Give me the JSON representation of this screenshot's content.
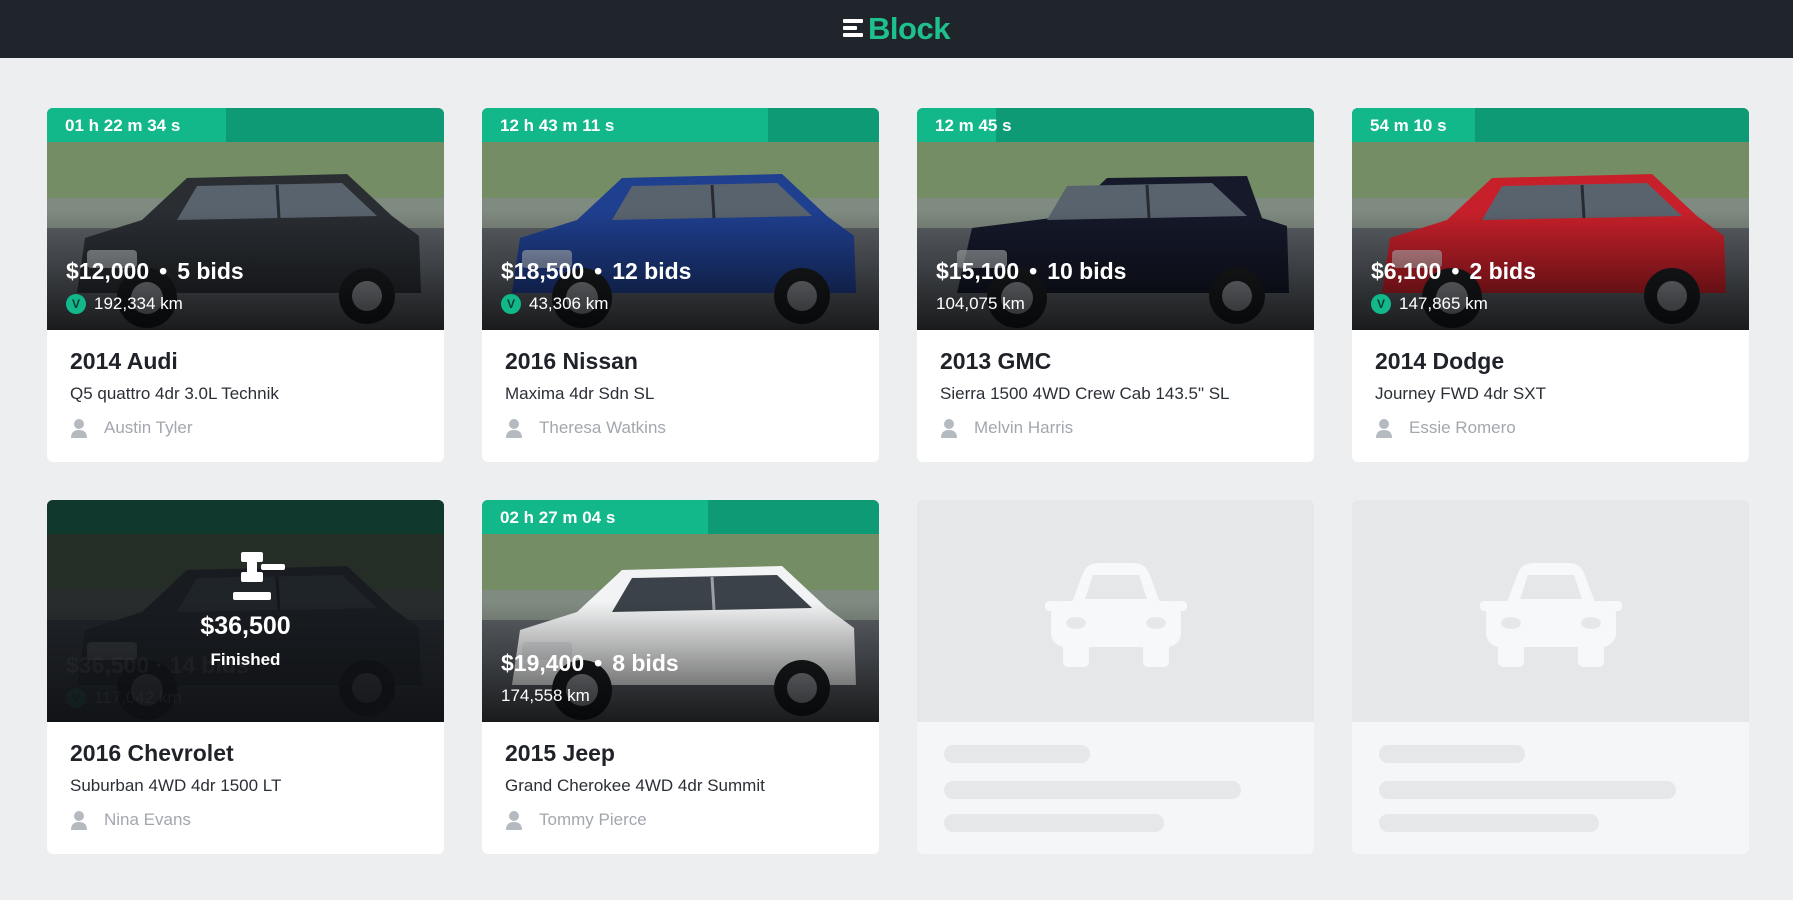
{
  "app": {
    "brand": "Block",
    "brand_color": "#1ec08f",
    "header_bg": "#20242b"
  },
  "listings": [
    {
      "timer": "01 h 22 m 34 s",
      "timer_progress": 0.45,
      "price": "$12,000",
      "bids": "5 bids",
      "km": "192,334 km",
      "verified": true,
      "title": "2014 Audi",
      "model": "Q5 quattro 4dr 3.0L Technik",
      "seller": "Austin Tyler",
      "car_color": "#2a2e33",
      "photo_icon": "car-photo-icon"
    },
    {
      "timer": "12 h 43 m 11 s",
      "timer_progress": 0.72,
      "price": "$18,500",
      "bids": "12 bids",
      "km": "43,306 km",
      "verified": true,
      "title": "2016 Nissan",
      "model": "Maxima 4dr Sdn SL",
      "seller": "Theresa Watkins",
      "car_color": "#1f3f8f",
      "photo_icon": "car-photo-icon"
    },
    {
      "timer": "12 m 45 s",
      "timer_progress": 0.2,
      "price": "$15,100",
      "bids": "10 bids",
      "km": "104,075 km",
      "verified": false,
      "title": "2013 GMC",
      "model": "Sierra 1500 4WD Crew Cab 143.5\" SL",
      "seller": "Melvin Harris",
      "car_color": "#15192a",
      "photo_icon": "truck-photo-icon"
    },
    {
      "timer": "54 m 10 s",
      "timer_progress": 0.31,
      "price": "$6,100",
      "bids": "2 bids",
      "km": "147,865 km",
      "verified": true,
      "title": "2014 Dodge",
      "model": "Journey FWD 4dr SXT",
      "seller": "Essie Romero",
      "car_color": "#c8202a",
      "photo_icon": "car-photo-icon"
    },
    {
      "finished": true,
      "final_price": "$36,500",
      "final_label": "Finished",
      "ghost_price": "$36,500 · 14 bids",
      "ghost_km": "117,042 km",
      "title": "2016 Chevrolet",
      "model": "Suburban 4WD 4dr 1500 LT",
      "seller": "Nina Evans",
      "car_color": "#3a3f45",
      "photo_icon": "suv-photo-icon"
    },
    {
      "timer": "02 h 27 m 04 s",
      "timer_progress": 0.57,
      "price": "$19,400",
      "bids": "8 bids",
      "km": "174,558 km",
      "verified": false,
      "title": "2015 Jeep",
      "model": "Grand Cherokee 4WD 4dr Summit",
      "seller": "Tommy Pierce",
      "car_color": "#f2f3f4",
      "photo_icon": "suv-photo-icon"
    }
  ],
  "placeholders": 2,
  "colors": {
    "timer_fill": "#12b78a",
    "timer_track": "#0e9a74",
    "muted_text": "#a2a7ae"
  }
}
